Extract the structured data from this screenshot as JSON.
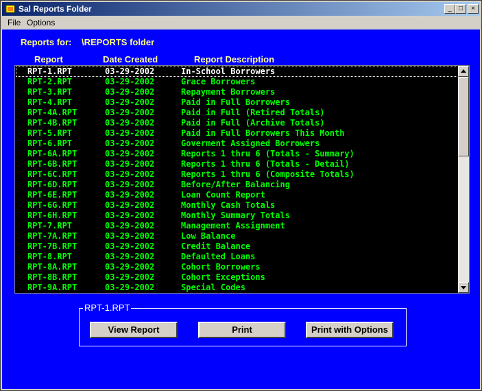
{
  "window": {
    "title": "Sal Reports Folder"
  },
  "menu": [
    {
      "label": "File"
    },
    {
      "label": "Options"
    }
  ],
  "header": {
    "reports_for_label": "Reports for:",
    "folder": "\\REPORTS folder"
  },
  "columns": {
    "report": "Report",
    "date": "Date Created",
    "description": "Report Description"
  },
  "rows": [
    {
      "report": "RPT-1.RPT",
      "date": "03-29-2002",
      "description": "In-School Borrowers"
    },
    {
      "report": "RPT-2.RPT",
      "date": "03-29-2002",
      "description": "Grace Borrowers"
    },
    {
      "report": "RPT-3.RPT",
      "date": "03-29-2002",
      "description": "Repayment Borrowers"
    },
    {
      "report": "RPT-4.RPT",
      "date": "03-29-2002",
      "description": "Paid in Full Borrowers"
    },
    {
      "report": "RPT-4A.RPT",
      "date": "03-29-2002",
      "description": "Paid in Full (Retired Totals)"
    },
    {
      "report": "RPT-4B.RPT",
      "date": "03-29-2002",
      "description": "Paid in Full (Archive Totals)"
    },
    {
      "report": "RPT-5.RPT",
      "date": "03-29-2002",
      "description": "Paid in Full Borrowers This Month"
    },
    {
      "report": "RPT-6.RPT",
      "date": "03-29-2002",
      "description": "Goverment Assigned Borrowers"
    },
    {
      "report": "RPT-6A.RPT",
      "date": "03-29-2002",
      "description": "Reports 1 thru 6 (Totals - Summary)"
    },
    {
      "report": "RPT-6B.RPT",
      "date": "03-29-2002",
      "description": "Reports 1 thru 6 (Totals - Detail)"
    },
    {
      "report": "RPT-6C.RPT",
      "date": "03-29-2002",
      "description": "Reports 1 thru 6 (Composite Totals)"
    },
    {
      "report": "RPT-6D.RPT",
      "date": "03-29-2002",
      "description": "Before/After Balancing"
    },
    {
      "report": "RPT-6E.RPT",
      "date": "03-29-2002",
      "description": "Loan Count Report"
    },
    {
      "report": "RPT-6G.RPT",
      "date": "03-29-2002",
      "description": "Monthly Cash Totals"
    },
    {
      "report": "RPT-6H.RPT",
      "date": "03-29-2002",
      "description": "Monthly Summary Totals"
    },
    {
      "report": "RPT-7.RPT",
      "date": "03-29-2002",
      "description": "Management Assignment"
    },
    {
      "report": "RPT-7A.RPT",
      "date": "03-29-2002",
      "description": "Low Balance"
    },
    {
      "report": "RPT-7B.RPT",
      "date": "03-29-2002",
      "description": "Credit Balance"
    },
    {
      "report": "RPT-8.RPT",
      "date": "03-29-2002",
      "description": "Defaulted Loans"
    },
    {
      "report": "RPT-8A.RPT",
      "date": "03-29-2002",
      "description": "Cohort Borrowers"
    },
    {
      "report": "RPT-8B.RPT",
      "date": "03-29-2002",
      "description": "Cohort Exceptions"
    },
    {
      "report": "RPT-9A.RPT",
      "date": "03-29-2002",
      "description": "Special Codes"
    }
  ],
  "selected": {
    "label": "RPT-1.RPT"
  },
  "buttons": {
    "view": "View Report",
    "print": "Print",
    "print_options": "Print with Options"
  },
  "colors": {
    "background": "#0000ff",
    "list_text": "#00ff00",
    "header_text": "#ffff80"
  }
}
